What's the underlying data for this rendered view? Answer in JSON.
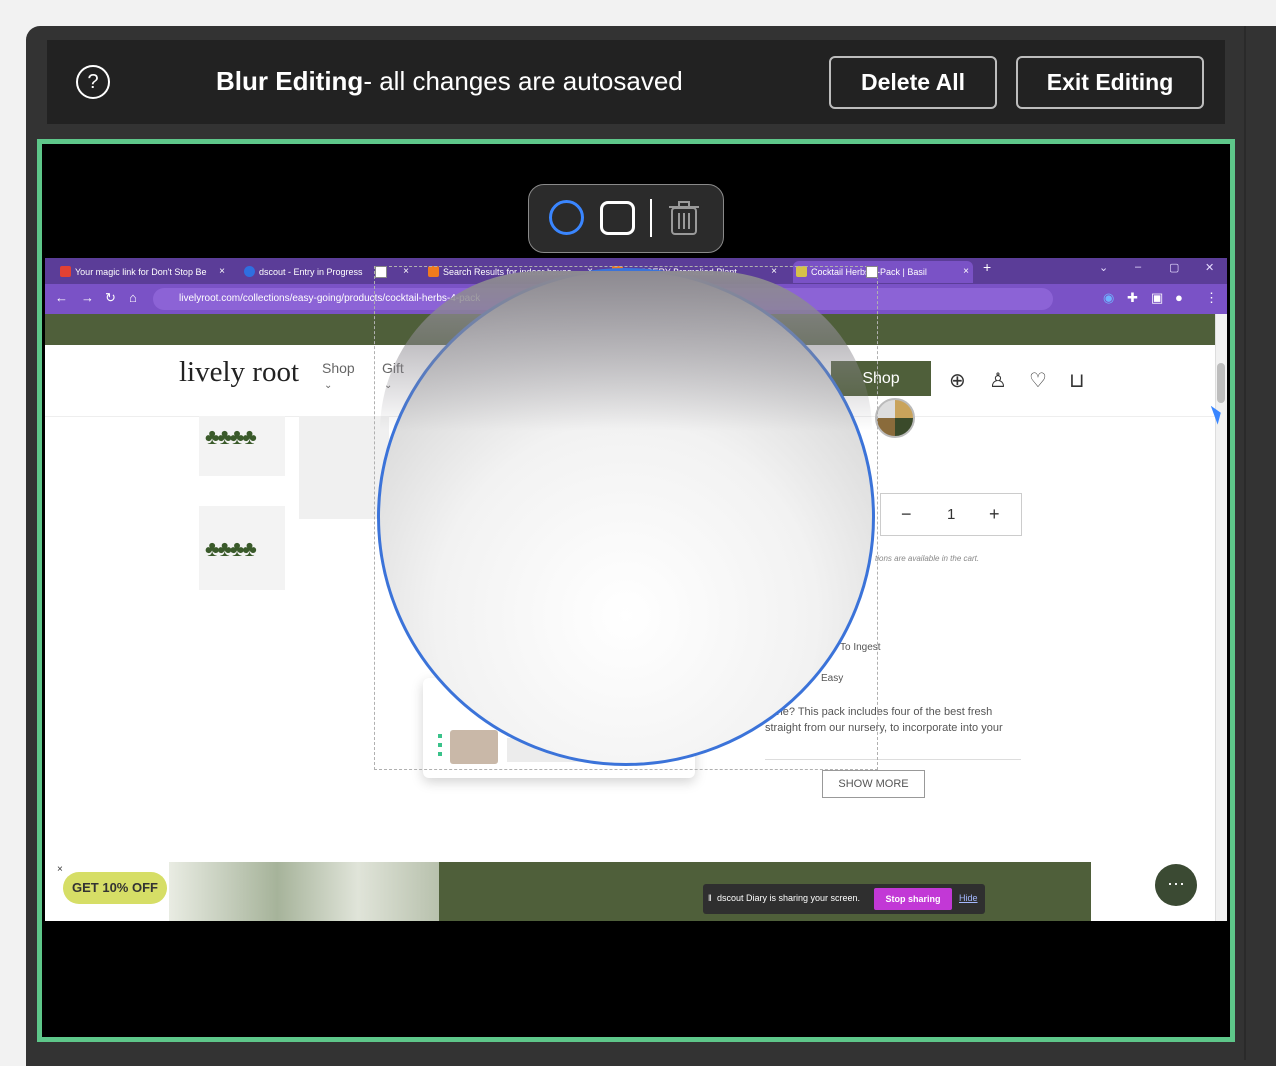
{
  "header": {
    "help_icon": "?",
    "title_bold": "Blur Editing",
    "title_rest": "- all changes are autosaved",
    "delete_all_label": "Delete All",
    "exit_editing_label": "Exit Editing"
  },
  "colors": {
    "frame_border": "#5ec78a",
    "accent_blue": "#3a86ff",
    "browser_purple": "#5b3d98",
    "site_green": "#4f5f3a"
  },
  "toolbar": {
    "tools": [
      "circle-tool",
      "rectangle-tool",
      "trash-icon"
    ]
  },
  "browser": {
    "tabs": [
      "Your magic link for Don't Stop Be",
      "dscout - Entry in Progress",
      "Search Results for indoor house",
      "NURSERY Bromeliad Plant",
      "Cocktail Herbs 4-Pack | Basil"
    ],
    "new_tab": "+",
    "url": "livelyroot.com/collections/easy-going/products/cocktail-herbs-4-pack"
  },
  "site": {
    "logo": "lively root",
    "nav": [
      "Shop",
      "Gift"
    ],
    "shop_button": "Shop",
    "quantity": "1",
    "qty_minus": "−",
    "qty_plus": "+",
    "note": "tions are available in the cart.",
    "feature_1": "To Ingest",
    "feature_2": "Easy",
    "description": "yone? This pack includes four of the best fresh straight from our nursery, to incorporate into your",
    "show_more": "SHOW MORE",
    "discount": "GET 10% OFF",
    "discount_close": "×"
  },
  "share_bar": {
    "text": "dscout Diary is sharing your screen.",
    "stop": "Stop sharing",
    "hide": "Hide"
  }
}
